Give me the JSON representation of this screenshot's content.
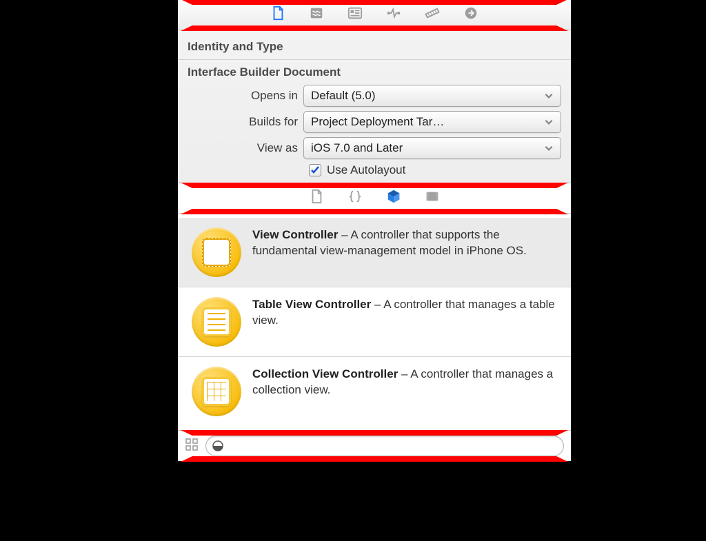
{
  "inspector_tabbar": {
    "icons": [
      "file-icon",
      "quickhelp-icon",
      "identity-icon",
      "attributes-icon",
      "size-icon",
      "connections-icon"
    ],
    "active_index": 0
  },
  "inspector": {
    "identity_title": "Identity and Type",
    "doc_title": "Interface Builder Document",
    "rows": {
      "opens_in": {
        "label": "Opens in",
        "value": "Default (5.0)"
      },
      "builds_for": {
        "label": "Builds for",
        "value": "Project Deployment Tar…"
      },
      "view_as": {
        "label": "View as",
        "value": "iOS 7.0 and Later"
      }
    },
    "autolayout": {
      "label": "Use Autolayout",
      "checked": true
    }
  },
  "library_tabbar": {
    "icons": [
      "file-template-icon",
      "code-snippet-icon",
      "object-library-icon",
      "media-library-icon"
    ],
    "active_index": 2
  },
  "library_items": [
    {
      "title": "View Controller",
      "desc": " – A controller that supports the fundamental view-management model in iPhone OS.",
      "icon": "view-controller-icon"
    },
    {
      "title": "Table View Controller",
      "desc": " – A controller that manages a table view.",
      "icon": "table-view-controller-icon"
    },
    {
      "title": "Collection View Controller",
      "desc": " – A controller that manages a collection view.",
      "icon": "collection-view-controller-icon"
    }
  ],
  "filter": {
    "placeholder": ""
  }
}
